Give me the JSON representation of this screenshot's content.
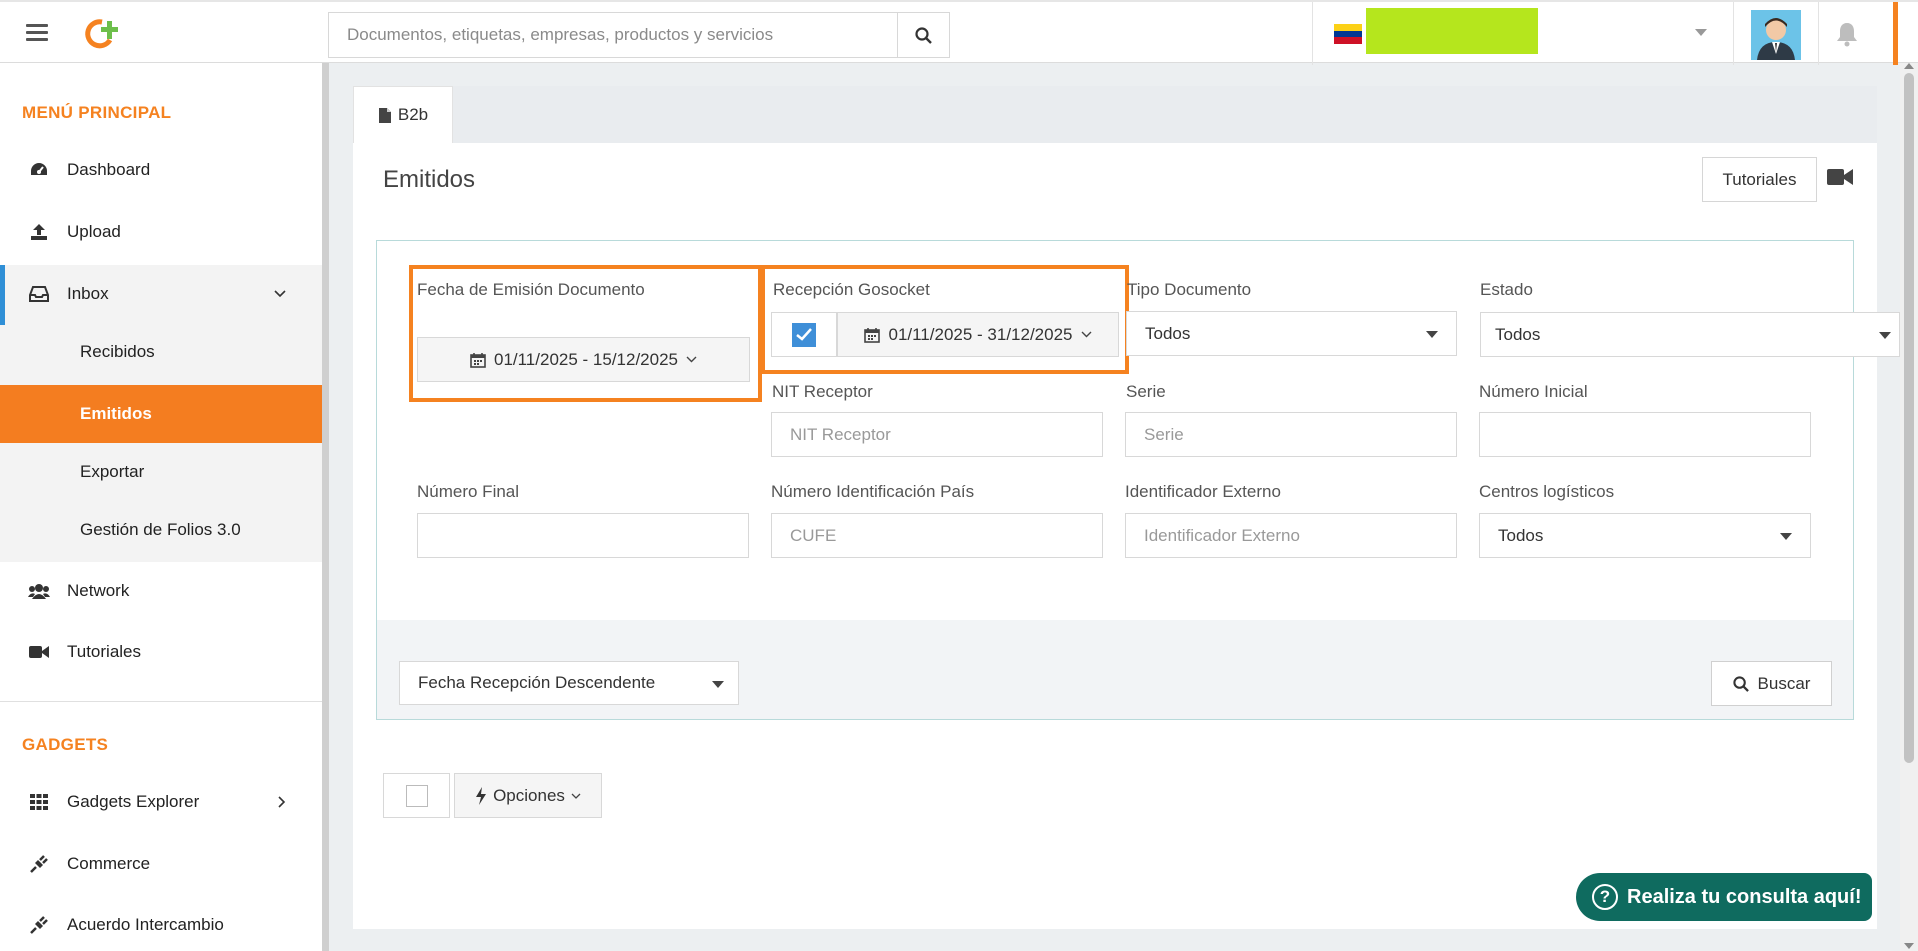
{
  "search": {
    "placeholder": "Documentos, etiquetas, empresas, productos y servicios"
  },
  "sidebar": {
    "main_title": "MENÚ PRINCIPAL",
    "items": [
      {
        "label": "Dashboard",
        "icon": "dashboard-icon"
      },
      {
        "label": "Upload",
        "icon": "upload-icon"
      },
      {
        "label": "Inbox",
        "icon": "inbox-icon"
      }
    ],
    "inbox_sub": [
      {
        "label": "Recibidos"
      },
      {
        "label": "Emitidos"
      },
      {
        "label": "Exportar"
      },
      {
        "label": "Gestión de Folios 3.0"
      }
    ],
    "items2": [
      {
        "label": "Network",
        "icon": "users-icon"
      },
      {
        "label": "Tutoriales",
        "icon": "video-camera-icon"
      }
    ],
    "gadgets_title": "GADGETS",
    "gadgets": [
      {
        "label": "Gadgets Explorer",
        "icon": "grid-icon"
      },
      {
        "label": "Commerce",
        "icon": "plug-icon"
      },
      {
        "label": "Acuerdo Intercambio",
        "icon": "plug-icon"
      }
    ]
  },
  "main": {
    "tab_label": "B2b",
    "page_title": "Emitidos",
    "tutorials_label": "Tutoriales",
    "filters": {
      "fecha_emision_label": "Fecha de Emisión Documento",
      "fecha_emision_value": "01/11/2025 - 15/12/2025",
      "recepcion_label": "Recepción Gosocket",
      "recepcion_value": "01/11/2025 - 31/12/2025",
      "tipo_label": "Tipo Documento",
      "tipo_value": "Todos",
      "estado_label": "Estado",
      "estado_value": "Todos",
      "nit_label": "NIT Receptor",
      "nit_placeholder": "NIT Receptor",
      "serie_label": "Serie",
      "serie_placeholder": "Serie",
      "num_inicial_label": "Número Inicial",
      "num_final_label": "Número Final",
      "num_id_label": "Número Identificación País",
      "num_id_placeholder": "CUFE",
      "ident_ext_label": "Identificador Externo",
      "ident_ext_placeholder": "Identificador Externo",
      "centros_label": "Centros logísticos",
      "centros_value": "Todos"
    },
    "sort_value": "Fecha Recepción Descendente",
    "buscar_label": "Buscar",
    "opciones_label": "Opciones"
  },
  "help": {
    "label": "Realiza tu consulta aquí!"
  },
  "colors": {
    "accent": "#f58220",
    "brand_green": "#0f6b5f",
    "checkbox_blue": "#3f8fd8"
  }
}
